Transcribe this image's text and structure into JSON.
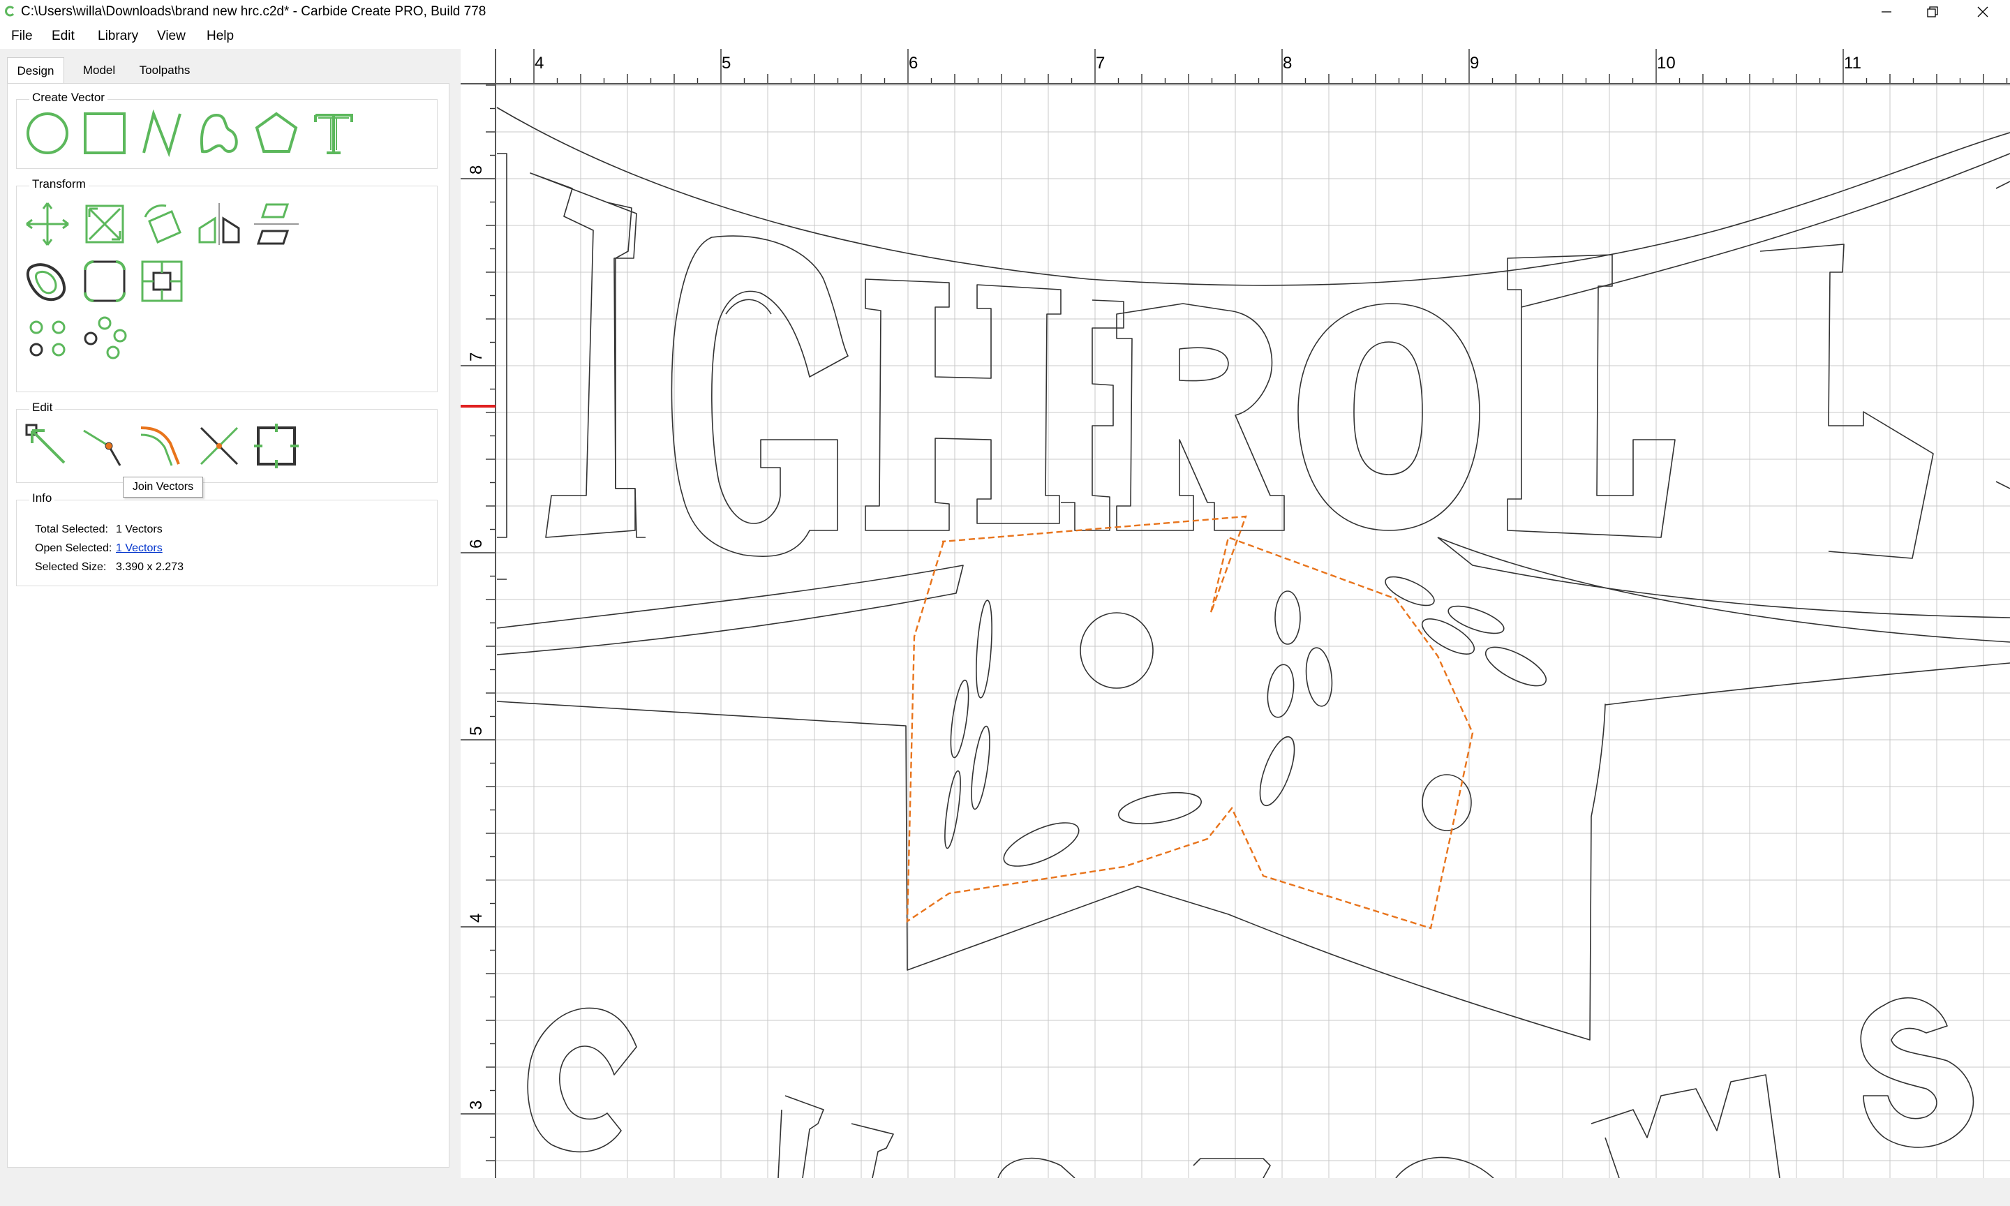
{
  "window": {
    "title": "C:\\Users\\willa\\Downloads\\brand new hrc.c2d* - Carbide Create PRO, Build 778",
    "app_icon": "carbide-create-icon",
    "controls": [
      "minimize-icon",
      "restore-icon",
      "close-icon"
    ]
  },
  "menu": {
    "items": [
      {
        "label": "File"
      },
      {
        "label": "Edit"
      },
      {
        "label": "Library"
      },
      {
        "label": "View"
      },
      {
        "label": "Help"
      }
    ]
  },
  "tabs": [
    {
      "label": "Design",
      "active": true
    },
    {
      "label": "Model",
      "active": false
    },
    {
      "label": "Toolpaths",
      "active": false
    }
  ],
  "create_vector": {
    "title": "Create Vector",
    "tools": [
      "circle-icon",
      "rectangle-icon",
      "polyline-icon",
      "curve-icon",
      "polygon-icon",
      "text-icon"
    ]
  },
  "transform": {
    "title": "Transform",
    "tools": [
      "move-icon",
      "scale-icon",
      "rotate-icon",
      "mirror-icon",
      "align-icon",
      "offset-icon",
      "fillet-icon",
      "inset-icon",
      "circular-array-icon",
      "linear-array-icon"
    ]
  },
  "edit": {
    "title": "Edit",
    "tools": [
      "node-edit-icon",
      "join-icon",
      "join-vectors-icon",
      "trim-icon",
      "boolean-icon"
    ],
    "tooltip": "Join Vectors"
  },
  "info": {
    "title": "Info",
    "total_selected_label": "Total Selected:",
    "total_selected_value": "1 Vectors",
    "open_selected_label": "Open Selected:",
    "open_selected_value": "1 Vectors",
    "selected_size_label": "Selected Size:",
    "selected_size_value": "3.390 x 2.273"
  },
  "ruler": {
    "x_labels": [
      "4",
      "5",
      "6",
      "7",
      "8",
      "9",
      "10",
      "11"
    ],
    "y_labels": [
      "8",
      "7",
      "6",
      "5",
      "4",
      "3"
    ]
  },
  "colors": {
    "accent_green": "#5cb85c",
    "selection_orange": "#e8741c",
    "grid": "#c8c8c8",
    "ruler_marker": "#e02020"
  }
}
